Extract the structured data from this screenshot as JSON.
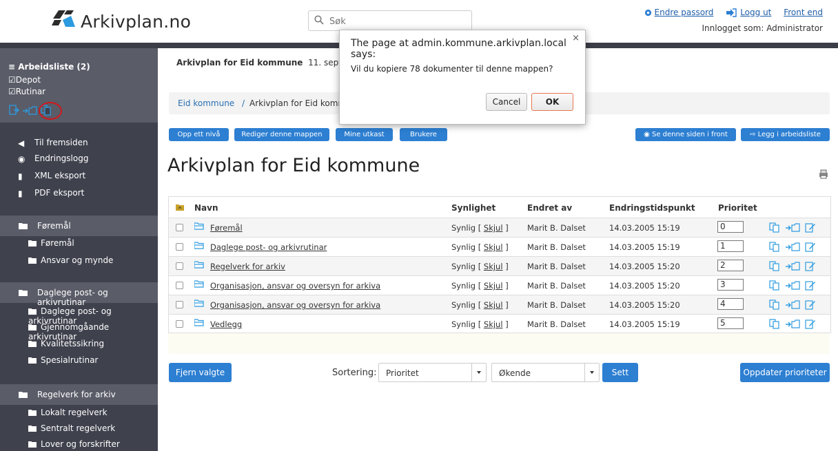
{
  "header": {
    "logo_text": "Arkivplan.no",
    "search_placeholder": "Søk",
    "links": {
      "change_password": "Endre passord",
      "logout": "Logg ut",
      "front_end": "Front end"
    },
    "logged_in": "Innlogget som: Administrator"
  },
  "sidebar": {
    "worklist": {
      "title": "Arbeidsliste (2)",
      "items": [
        "Depot",
        "Rutinar"
      ]
    },
    "nav": [
      "Til fremsiden",
      "Endringslogg",
      "XML eksport",
      "PDF eksport"
    ],
    "sections": [
      {
        "title": "Føremål",
        "items": [
          "Føremål",
          "Ansvar og mynde"
        ]
      },
      {
        "title": "Daglege post- og arkivrutinar",
        "items": [
          "Daglege post- og arkivrutinar",
          "Gjennomgåande arkivrutinar",
          "Kvalitetssikring",
          "Spesialrutinar"
        ]
      },
      {
        "title": "Regelverk for arkiv",
        "items": [
          "Lokalt regelverk",
          "Sentralt regelverk",
          "Lover og forskrifter"
        ]
      }
    ]
  },
  "main": {
    "top_title": "Arkivplan for Eid kommune",
    "top_date": "11. september",
    "breadcrumb": {
      "link": "Eid kommune",
      "sep": "/",
      "current": "Arkivplan for Eid kommune"
    },
    "buttons": {
      "up": "Opp ett nivå",
      "edit": "Rediger denne mappen",
      "drafts": "Mine utkast",
      "users": "Brukere",
      "view_front": "Se denne siden i front",
      "add_worklist": "Legg i arbeidsliste"
    },
    "heading": "Arkivplan for Eid kommune",
    "table": {
      "headers": [
        "Navn",
        "Synlighet",
        "Endret av",
        "Endringstidspunkt",
        "Prioritet"
      ],
      "rows": [
        {
          "name": "Føremål",
          "vis": "Synlig",
          "hide": "Skjul",
          "by": "Marit B. Dalset",
          "time": "14.03.2005 15:19",
          "prio": "0"
        },
        {
          "name": "Daglege post- og arkivrutinar",
          "vis": "Synlig",
          "hide": "Skjul",
          "by": "Marit B. Dalset",
          "time": "14.03.2005 15:19",
          "prio": "1"
        },
        {
          "name": "Regelverk for arkiv",
          "vis": "Synlig",
          "hide": "Skjul",
          "by": "Marit B. Dalset",
          "time": "14.03.2005 15:20",
          "prio": "2"
        },
        {
          "name": "Organisasjon, ansvar og oversyn for arkiva",
          "vis": "Synlig",
          "hide": "Skjul",
          "by": "Marit B. Dalset",
          "time": "14.03.2005 15:20",
          "prio": "3"
        },
        {
          "name": "Organisasjon, ansvar og oversyn for arkiva",
          "vis": "Synlig",
          "hide": "Skjul",
          "by": "Marit B. Dalset",
          "time": "14.03.2005 15:20",
          "prio": "4"
        },
        {
          "name": "Vedlegg",
          "vis": "Synlig",
          "hide": "Skjul",
          "by": "Marit B. Dalset",
          "time": "14.03.2005 15:19",
          "prio": "5"
        }
      ]
    },
    "footer": {
      "remove": "Fjern valgte",
      "sort_label": "Sortering:",
      "sort_field": "Prioritet",
      "sort_order": "Økende",
      "set": "Sett",
      "update": "Oppdater prioriteter"
    }
  },
  "dialog": {
    "title": "The page at admin.kommune.arkivplan.local says:",
    "close": "×",
    "message": "Vil du kopiere 78 dokumenter til denne mappen?",
    "cancel": "Cancel",
    "ok": "OK"
  },
  "colors": {
    "accent": "#2d7fd2",
    "sidebar": "#3f414d",
    "sidebar_section": "#5a5c68",
    "highlight": "#d0181e"
  }
}
